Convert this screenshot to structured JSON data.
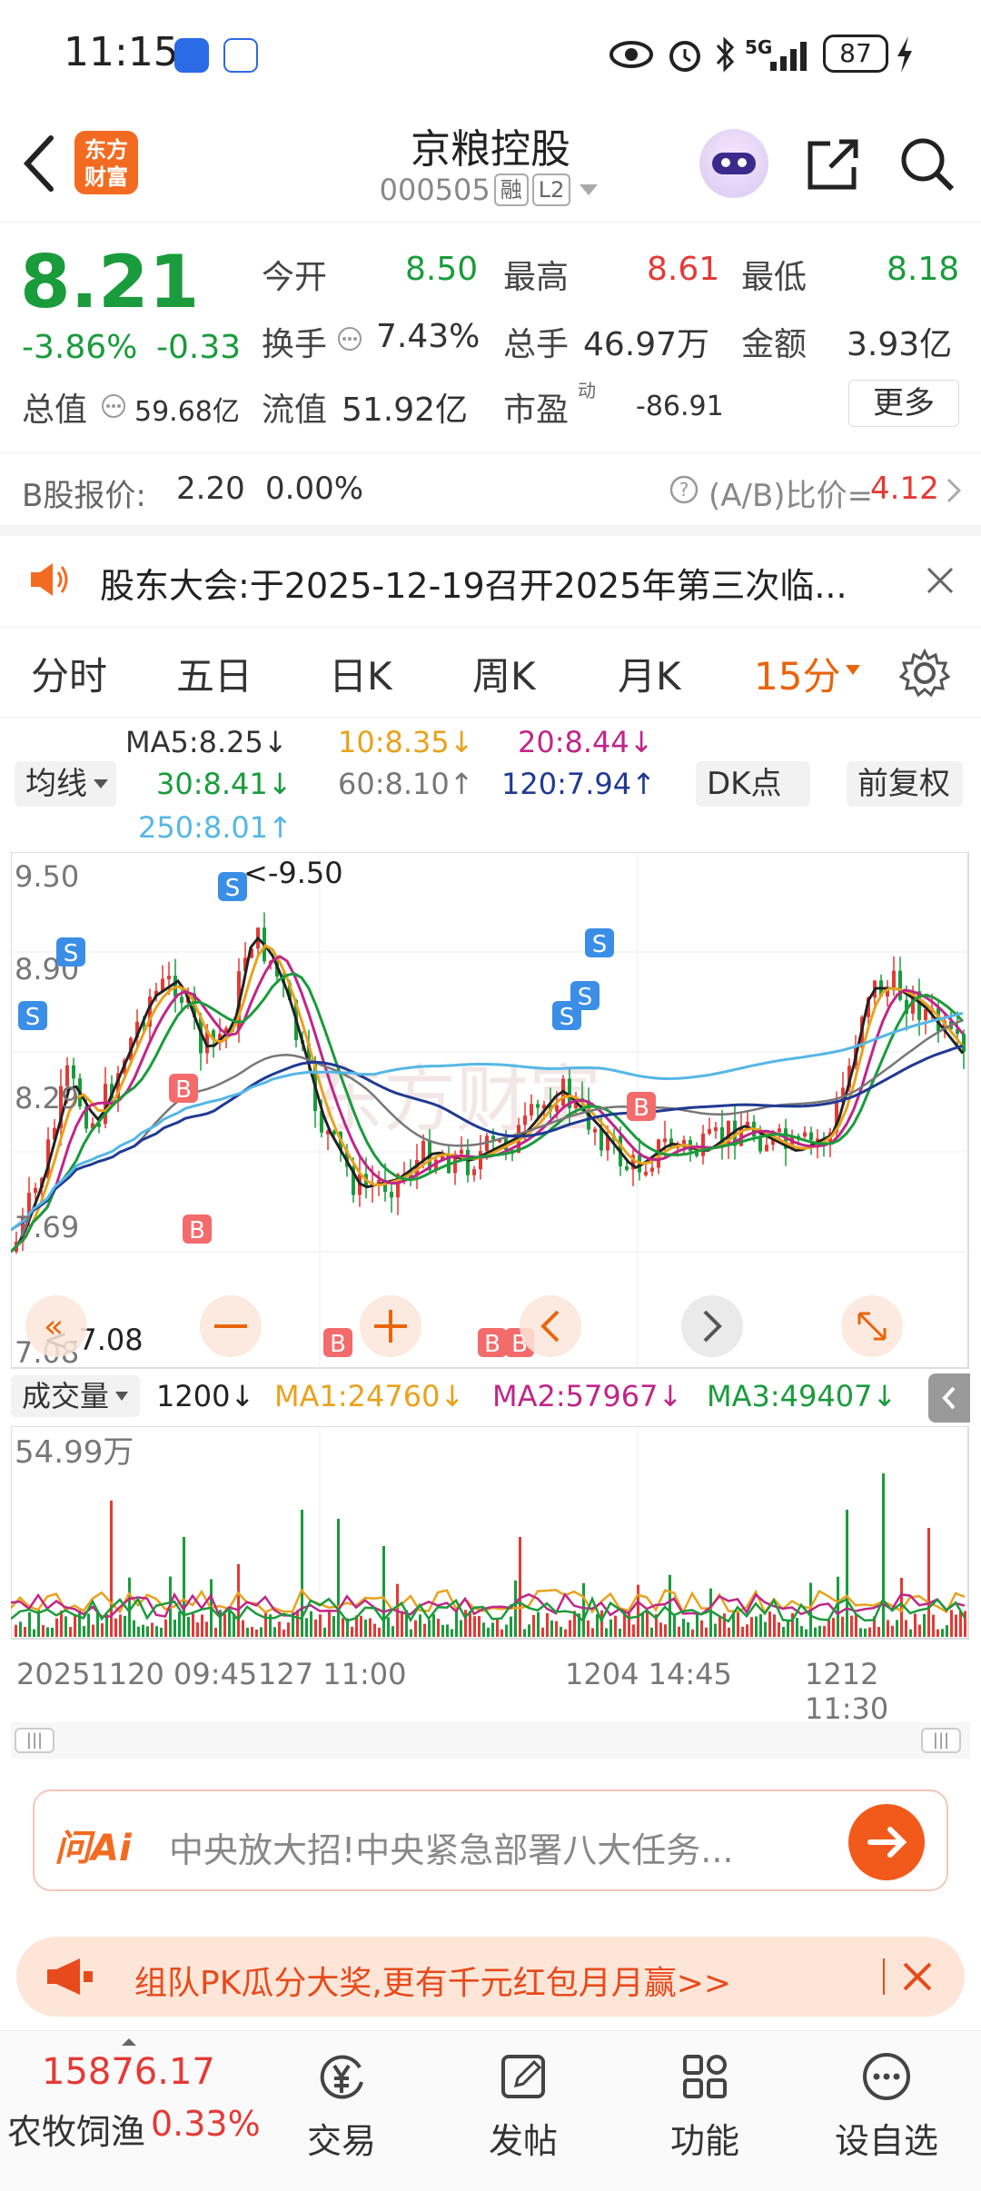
{
  "status_bar": {
    "time": "11:15",
    "battery": "87",
    "network": "5G"
  },
  "header": {
    "back_icon": "chevron-left-icon",
    "logo_text_line1": "东方",
    "logo_text_line2": "财富",
    "stock_name": "京粮控股",
    "stock_code": "000505",
    "badge_margin": "融",
    "badge_level": "L2",
    "share_icon": "share-icon",
    "search_icon": "search-icon"
  },
  "quote": {
    "price": "8.21",
    "change_pct": "-3.86%",
    "change_amt": "-0.33",
    "open_label": "今开",
    "open_value": "8.50",
    "high_label": "最高",
    "high_value": "8.61",
    "low_label": "最低",
    "low_value": "8.18",
    "turnover_label": "换手",
    "turnover_value": "7.43%",
    "volume_label": "总手",
    "volume_value": "46.97万",
    "amount_label": "金额",
    "amount_value": "3.93亿",
    "mktcap_label": "总值",
    "mktcap_value": "59.68亿",
    "float_label": "流值",
    "float_value": "51.92亿",
    "pe_label": "市盈",
    "pe_sup": "动",
    "pe_value": "-86.91",
    "more_button": "更多"
  },
  "bshare": {
    "label": "B股报价:",
    "price": "2.20",
    "pct": "0.00%",
    "ratio_label": "(A/B)比价=",
    "ratio_value": "4.12"
  },
  "notice": {
    "text": "股东大会:于2025-12-19召开2025年第三次临..."
  },
  "tabs": [
    {
      "label": "分时"
    },
    {
      "label": "五日"
    },
    {
      "label": "日K"
    },
    {
      "label": "周K"
    },
    {
      "label": "月K"
    },
    {
      "label": "15分"
    }
  ],
  "ma": {
    "ma5": "MA5:8.25↓",
    "ma10": "10:8.35↓",
    "ma20": "20:8.44↓",
    "ma30": "30:8.41↓",
    "ma60": "60:8.10↑",
    "ma120": "120:7.94↑",
    "ma250": "250:8.01↑",
    "indicator_select": "均线",
    "dk_button": "DK点",
    "adjust_button": "前复权"
  },
  "kchart": {
    "ymax": "9.50",
    "y2": "8.90",
    "y3": "8.29",
    "y4": "7.69",
    "ymin": "7.08",
    "peak_label": "<-9.50",
    "low_label": "<-7.08",
    "watermark": "东方财富"
  },
  "volume": {
    "select": "成交量",
    "vol_text": "1200↓",
    "ma1": "MA1:24760↓",
    "ma2": "MA2:57967↓",
    "ma3": "MA3:49407↓",
    "ymax": "54.99万"
  },
  "xaxis": {
    "t1": "20251120 09:45",
    "t2": "127 11:00",
    "t3": "1204 14:45",
    "t4": "1212 11:30"
  },
  "ai_bar": {
    "logo": "问Ai",
    "text": "中央放大招!中央紧急部署八大任务..."
  },
  "promo": {
    "text": "组队PK瓜分大奖,更有千元红包月月赢>>"
  },
  "bottom_nav": {
    "index_value": "15876.17",
    "index_name": "农牧饲渔",
    "index_pct": "0.33%",
    "trade": "交易",
    "post": "发帖",
    "func": "功能",
    "watch": "设自选"
  },
  "colors": {
    "up": "#e53935",
    "down": "#1a9b3c",
    "accent": "#f26b21"
  }
}
